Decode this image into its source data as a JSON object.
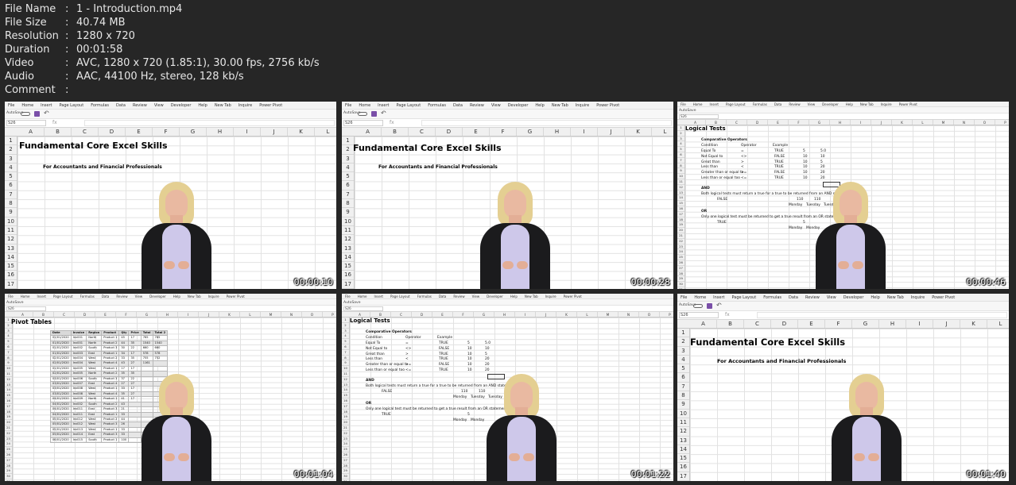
{
  "metadata": [
    {
      "key": "File Name",
      "value": "1 - Introduction.mp4"
    },
    {
      "key": "File Size",
      "value": "40.74 MB"
    },
    {
      "key": "Resolution",
      "value": "1280 x 720"
    },
    {
      "key": "Duration",
      "value": "00:01:58"
    },
    {
      "key": "Video",
      "value": "AVC, 1280 x 720 (1.85:1), 30.00 fps, 2756 kb/s"
    },
    {
      "key": "Audio",
      "value": "AAC, 44100 Hz, stereo, 128 kb/s"
    },
    {
      "key": "Comment",
      "value": ""
    }
  ],
  "separator": ":",
  "ribbon_tabs": [
    "File",
    "Home",
    "Insert",
    "Page Layout",
    "Formulas",
    "Data",
    "Review",
    "View",
    "Developer",
    "Help",
    "New Tab",
    "Inquire",
    "Power Pivot"
  ],
  "autosave_label": "AutoSave",
  "name_box": "S26",
  "fx": "fx",
  "columns_big": [
    "A",
    "B",
    "C",
    "D",
    "E",
    "F",
    "G",
    "H",
    "I",
    "J",
    "K",
    "L"
  ],
  "columns_small": [
    "A",
    "B",
    "C",
    "D",
    "E",
    "F",
    "G",
    "H",
    "I",
    "J",
    "K",
    "L",
    "M",
    "N",
    "O",
    "P",
    "Q",
    "R"
  ],
  "rows_big": [
    "1",
    "2",
    "3",
    "4",
    "5",
    "6",
    "7",
    "8",
    "9",
    "10",
    "11",
    "12",
    "13",
    "14",
    "15",
    "16",
    "17",
    "18"
  ],
  "rows_small": [
    "1",
    "2",
    "3",
    "4",
    "5",
    "6",
    "7",
    "8",
    "9",
    "10",
    "11",
    "12",
    "13",
    "14",
    "15",
    "16",
    "17",
    "18",
    "19",
    "20",
    "21",
    "22",
    "23",
    "24",
    "25",
    "26",
    "27",
    "28",
    "29",
    "30",
    "31"
  ],
  "intro_sheet": {
    "title": "Fundamental Core Excel Skills",
    "subtitle": "For Accountants and Financial Professionals"
  },
  "logic_sheet": {
    "title": "Logical Tests",
    "section": "Comparative Operators",
    "headers": [
      "Condition",
      "Operator",
      "Example"
    ],
    "rows": [
      [
        "Equal To",
        "=",
        "TRUE",
        "5",
        "5.0"
      ],
      [
        "Not Equal to",
        "<>",
        "FALSE",
        "10",
        "10"
      ],
      [
        "Great than",
        ">",
        "TRUE",
        "10",
        "5"
      ],
      [
        "Less than",
        "<",
        "TRUE",
        "10",
        "20"
      ],
      [
        "Greater than or equal to",
        ">=",
        "FALSE",
        "10",
        "20"
      ],
      [
        "Less than or equal too",
        "<=",
        "TRUE",
        "10",
        "20"
      ]
    ],
    "and_label": "AND",
    "and_text": "Both logical tests must return a true for a true to be returned from an AND statement",
    "and_result": "FALSE",
    "and_values": [
      "110",
      "110"
    ],
    "and_days": [
      "Monday",
      "Tuesday",
      "Tuesday"
    ],
    "or_label": "OR",
    "or_text": "Only one logical test must be returned to get a true result from an OR statement",
    "or_result": "TRUE",
    "or_value": "5",
    "or_days": [
      "Monday",
      "Monday"
    ]
  },
  "pivot_sheet": {
    "title": "Pivot Tables",
    "headers": [
      "Date",
      "Invoice",
      "Region",
      "Product",
      "Qty",
      "Price",
      "Total",
      "Total 2"
    ],
    "rows": [
      [
        "01/01/2020",
        "Inv001",
        "North",
        "Product 1",
        "45",
        "17",
        "765",
        "765"
      ],
      [
        "01/01/2020",
        "Inv001",
        "North",
        "Product 2",
        "44",
        "35",
        "1540",
        "1540"
      ],
      [
        "01/01/2020",
        "Inv002",
        "South",
        "Product 3",
        "30",
        "22",
        "660",
        "660"
      ],
      [
        "01/01/2020",
        "Inv003",
        "East",
        "Product 1",
        "34",
        "17",
        "578",
        "578"
      ],
      [
        "02/01/2020",
        "Inv004",
        "West",
        "Product 2",
        "33",
        "35",
        "755",
        "752"
      ],
      [
        "02/01/2020",
        "Inv004",
        "West",
        "Product 4",
        "43",
        "27",
        "1161",
        ""
      ],
      [
        "01/01/2020",
        "Inv005",
        "West",
        "Product 1",
        "17",
        "17",
        "",
        ""
      ],
      [
        "02/01/2020",
        "Inv005",
        "North",
        "Product 2",
        "35",
        "35",
        "",
        ""
      ],
      [
        "03/01/2020",
        "Inv006",
        "South",
        "Product 3",
        "37",
        "22",
        "",
        ""
      ],
      [
        "03/01/2020",
        "Inv007",
        "East",
        "Product 4",
        "27",
        "27",
        "",
        ""
      ],
      [
        "03/01/2020",
        "Inv008",
        "West",
        "Product 1",
        "33",
        "17",
        "",
        ""
      ],
      [
        "03/01/2020",
        "Inv008",
        "West",
        "Product 4",
        "35",
        "27",
        "",
        ""
      ],
      [
        "04/01/2020",
        "Inv009",
        "North",
        "Product 1",
        "41",
        "17",
        "",
        ""
      ],
      [
        "04/01/2020",
        "Inv002",
        "South",
        "Product 2",
        "43",
        "",
        "",
        ""
      ],
      [
        "04/01/2020",
        "Inv011",
        "East",
        "Product 3",
        "21",
        "",
        "",
        ""
      ],
      [
        "04/01/2020",
        "Inv011",
        "East",
        "Product 1",
        "33",
        "",
        "",
        ""
      ],
      [
        "05/01/2020",
        "Inv012",
        "West",
        "Product 2",
        "44",
        "",
        "",
        ""
      ],
      [
        "05/01/2020",
        "Inv012",
        "West",
        "Product 3",
        "26",
        "",
        "",
        ""
      ],
      [
        "05/01/2020",
        "Inv013",
        "West",
        "Product 1",
        "33",
        "",
        "",
        ""
      ],
      [
        "05/01/2020",
        "Inv014",
        "East",
        "Product 3",
        "33",
        "",
        "",
        ""
      ],
      [
        "06/01/2020",
        "Inv015",
        "South",
        "Product 1",
        "100",
        "",
        "",
        ""
      ]
    ]
  },
  "timestamps": [
    "00:00:10",
    "00:00:28",
    "00:00:46",
    "00:01:04",
    "00:01:22",
    "00:01:40"
  ],
  "colors": {
    "background": "#262626",
    "text": "#e6e6e6",
    "sheet": "#ffffff",
    "presenter_top": "#cec8ea"
  }
}
